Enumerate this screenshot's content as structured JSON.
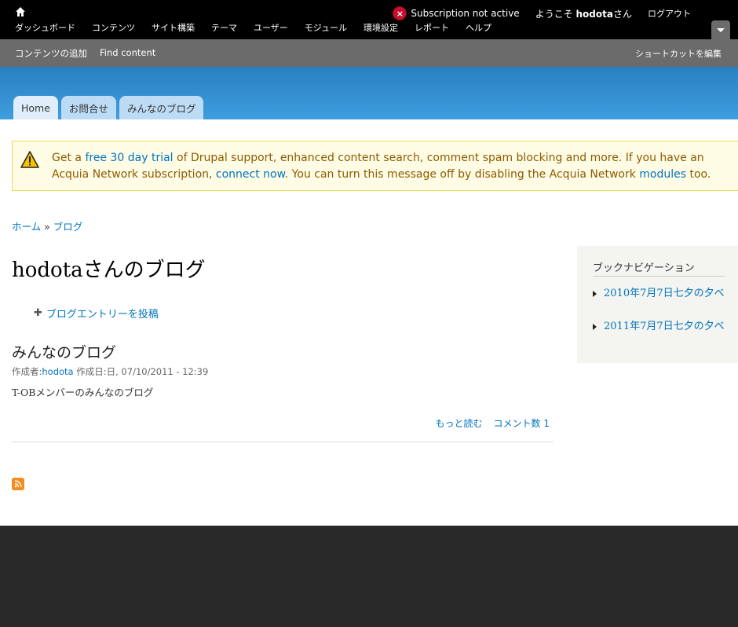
{
  "toolbar": {
    "menu": [
      "ダッシュボード",
      "コンテンツ",
      "サイト構築",
      "テーマ",
      "ユーザー",
      "モジュール",
      "環境設定",
      "レポート",
      "ヘルプ"
    ],
    "subscription_status": "Subscription not active",
    "welcome_prefix": "ようこそ ",
    "username": "hodota",
    "welcome_suffix": "さん",
    "logout": "ログアウト"
  },
  "shortcuts": {
    "items": [
      "コンテンツの追加",
      "Find content"
    ],
    "edit": "ショートカットを編集"
  },
  "tabs": [
    "Home",
    "お問合せ",
    "みんなのブログ"
  ],
  "message": {
    "t1": "Get a ",
    "link1": "free 30 day trial",
    "t2": " of Drupal support, enhanced content search, comment spam blocking and more. If you have an Acquia Network subscription, ",
    "link2": "connect now",
    "t3": ". You can turn this message off by disabling the Acquia Network ",
    "link3": "modules",
    "t4": " too."
  },
  "breadcrumb": {
    "home": "ホーム",
    "sep": " » ",
    "blog": "ブログ"
  },
  "page_title": "hodotaさんのブログ",
  "add_entry": "ブログエントリーを投稿",
  "node": {
    "title": "みんなのブログ",
    "author_label": "作成者:",
    "author": "hodota",
    "date": " 作成日:日, 07/10/2011 - 12:39",
    "body": "T-OBメンバーのみんなのブログ",
    "read_more": "もっと読む",
    "comments": "コメント数 1"
  },
  "sidebar": {
    "title": "ブックナビゲーション",
    "items": [
      "2010年7月7日七夕の夕べ",
      "2011年7月7日七夕の夕べ"
    ]
  },
  "colors": {
    "link": "#0074bd",
    "header_blue": "#3d9ede",
    "footer": "#292929"
  }
}
